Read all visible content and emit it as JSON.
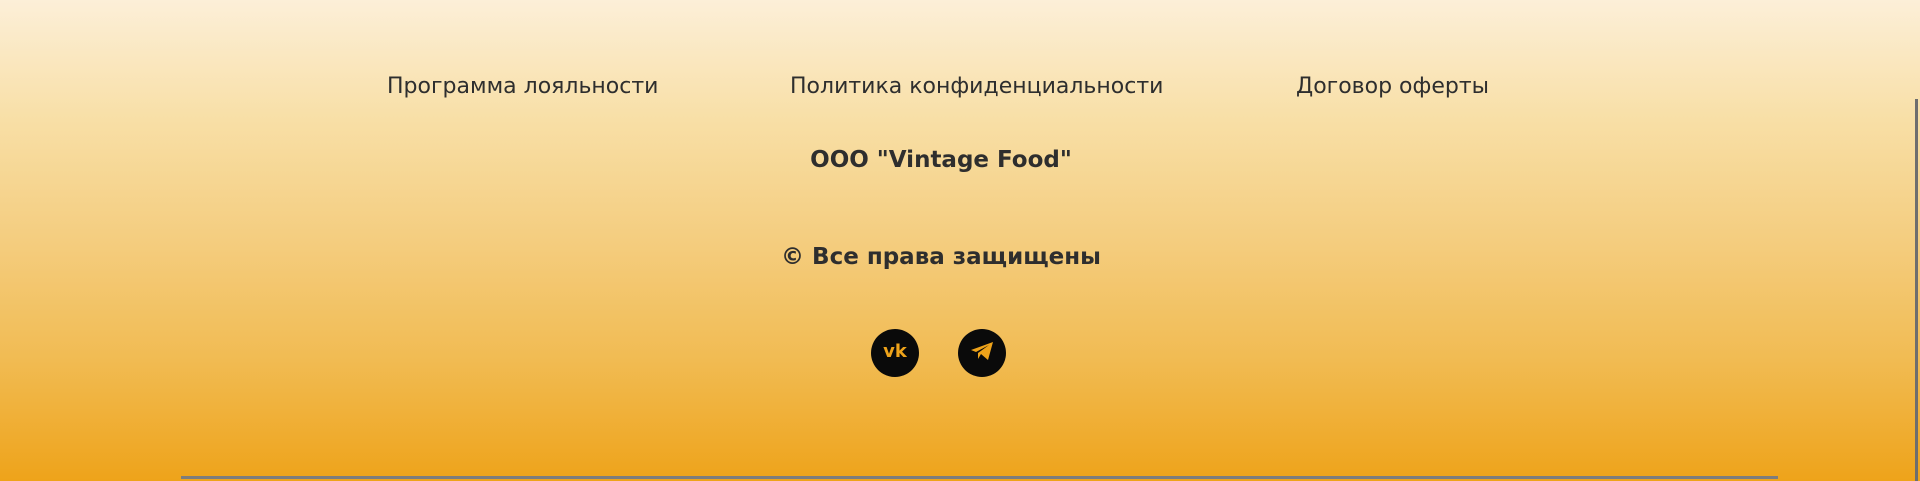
{
  "footer": {
    "links": [
      {
        "label": "Программа лояльности"
      },
      {
        "label": "Политика конфиденциальности"
      },
      {
        "label": "Договор оферты"
      }
    ],
    "company": "ООО \"Vintage Food\"",
    "rights": "© Все права защищены",
    "social": [
      {
        "icon": "vk-icon"
      },
      {
        "icon": "telegram-icon"
      }
    ]
  },
  "colors": {
    "gradient_top": "#fcefd8",
    "gradient_bottom": "#eea31a",
    "text": "#2e2e2e",
    "icon_bg": "#0a0a0a",
    "icon_fg": "#eea31a"
  }
}
